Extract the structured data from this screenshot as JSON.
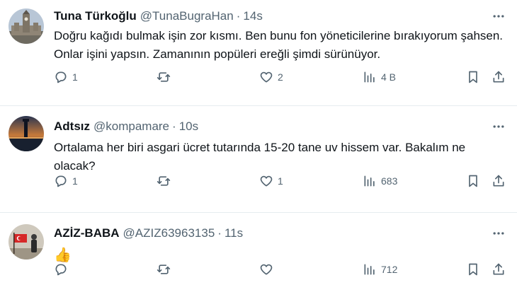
{
  "tweets": [
    {
      "name": "Tuna Türkoğlu",
      "handle": "@TunaBugraHan",
      "separator": "·",
      "time": "14s",
      "text": "Doğru kağıdı bulmak işin zor kısmı. Ben bunu fon yöneticilerine bırakıyorum şahsen. Onlar işini yapsın. Zamanının popüleri ereğli şimdi sürünüyor.",
      "replies": "1",
      "retweets": "",
      "likes": "2",
      "views": "4 B",
      "avatar_icon": "clock-tower-photo"
    },
    {
      "name": "Adtsız",
      "handle": "@kompamare",
      "separator": "·",
      "time": "10s",
      "text": "Ortalama her biri asgari ücret tutarında 15-20 tane uv hissem var. Bakalım ne olacak?",
      "replies": "1",
      "retweets": "",
      "likes": "1",
      "views": "683",
      "avatar_icon": "lighthouse-sunset-photo"
    },
    {
      "name": "AZİZ-BABA",
      "handle": "@AZIZ63963135",
      "separator": "·",
      "time": "11s",
      "text": "👍",
      "replies": "",
      "retweets": "",
      "likes": "",
      "views": "712",
      "avatar_icon": "soldier-with-flag-photo"
    }
  ],
  "colors": {
    "text": "#0f1419",
    "secondary": "#536471",
    "divider": "#e6ecf0"
  }
}
